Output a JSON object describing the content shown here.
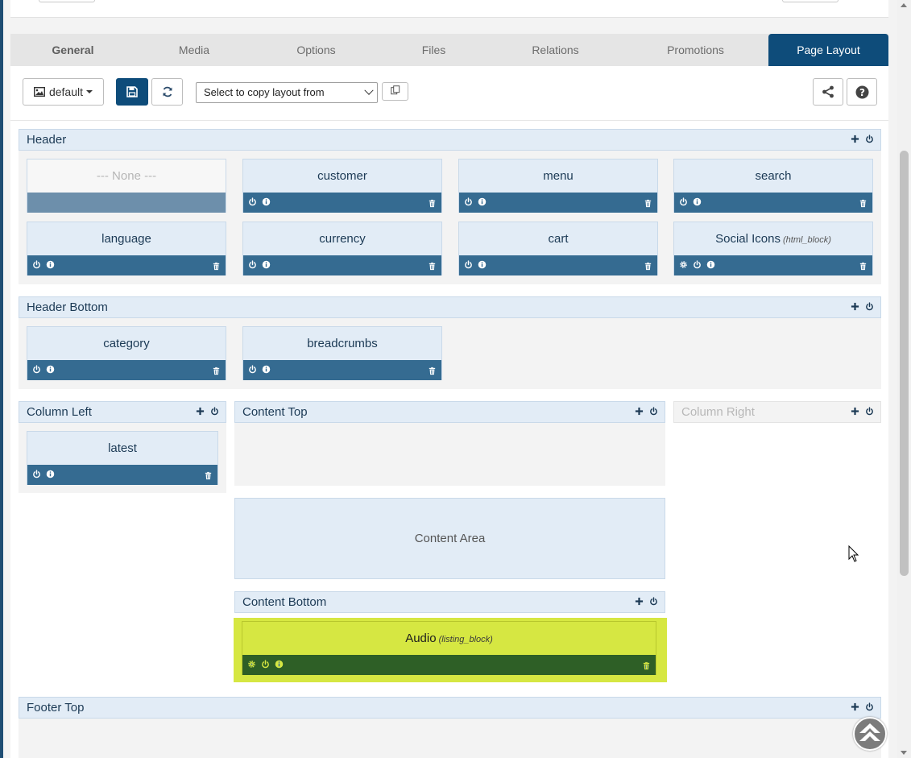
{
  "tabs": [
    "General",
    "Media",
    "Options",
    "Files",
    "Relations",
    "Promotions",
    "Page Layout"
  ],
  "active_tab": "Page Layout",
  "toolbar": {
    "template_button": "default",
    "copy_select_placeholder": "Select to copy layout from"
  },
  "sections": {
    "header": "Header",
    "header_bottom": "Header Bottom",
    "column_left": "Column Left",
    "content_top": "Content Top",
    "column_right": "Column Right",
    "content_area": "Content Area",
    "content_bottom": "Content Bottom",
    "footer_top": "Footer Top"
  },
  "header_modules": [
    {
      "title": "--- None ---"
    },
    {
      "title": "customer"
    },
    {
      "title": "menu"
    },
    {
      "title": "search"
    },
    {
      "title": "language"
    },
    {
      "title": "currency"
    },
    {
      "title": "cart"
    },
    {
      "title": "Social Icons",
      "type": "(html_block)"
    }
  ],
  "header_bottom_modules": [
    {
      "title": "category"
    },
    {
      "title": "breadcrumbs"
    }
  ],
  "column_left_modules": [
    {
      "title": "latest"
    }
  ],
  "content_bottom_modules": [
    {
      "title": "Audio",
      "type": "(listing_block)"
    }
  ],
  "icons": [
    "image-icon",
    "save-icon",
    "refresh-icon",
    "copy-icon",
    "share-icon",
    "help-icon",
    "plus-icon",
    "power-icon",
    "info-icon",
    "trash-icon",
    "gear-icon",
    "scroll-to-top-icon"
  ],
  "colors": {
    "primary": "#0e4c7a",
    "module_bar": "#356b91",
    "section_head": "#e2ecf6",
    "highlight": "#d6e742",
    "highlight_bar": "#2e5f26"
  }
}
